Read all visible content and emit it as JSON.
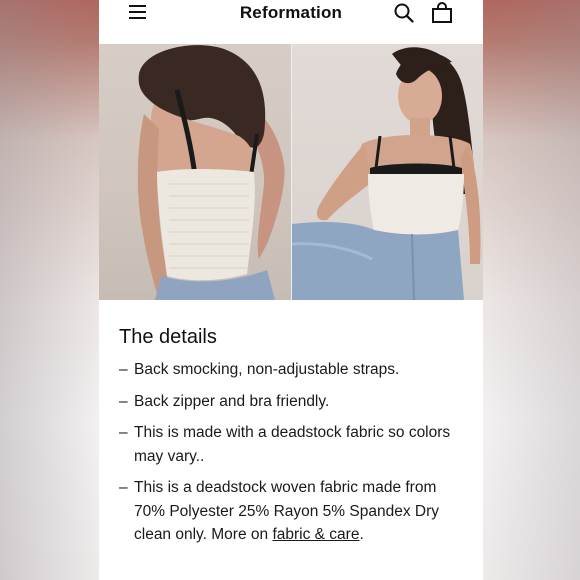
{
  "header": {
    "brand": "Reformation"
  },
  "gallery": {
    "images": [
      {
        "alt": "Back view of model wearing white corset top with smocking"
      },
      {
        "alt": "Front view of model wearing white corset top and jeans"
      }
    ]
  },
  "details": {
    "title": "The details",
    "items": [
      "Back smocking, non-adjustable straps.",
      "Back zipper and bra friendly.",
      "This is made with a deadstock fabric so colors may vary..",
      "This is a deadstock woven fabric made from 70% Polyester 25% Rayon 5% Spandex Dry clean only. More on "
    ],
    "link_text": "fabric & care",
    "link_suffix": ".",
    "dash": "–"
  },
  "colors": {
    "text": "#1a1a1a",
    "background": "#ffffff"
  }
}
